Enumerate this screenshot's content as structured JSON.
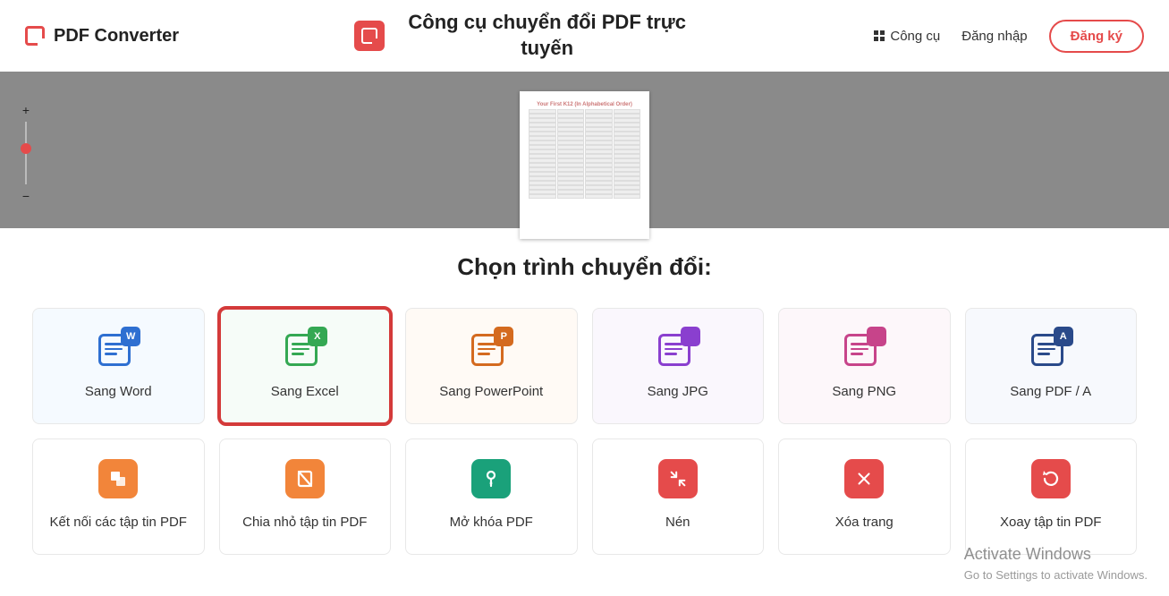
{
  "header": {
    "brand": "PDF Converter",
    "title": "Công cụ chuyển đổi PDF trực tuyến",
    "nav_tools": "Công cụ",
    "nav_login": "Đăng nhập",
    "nav_signup": "Đăng ký"
  },
  "preview": {
    "doc_heading": "Your First K12 (In Alphabetical Order)"
  },
  "section_title": "Chọn trình chuyển đổi:",
  "converters": [
    {
      "label": "Sang Word",
      "badge": "W",
      "tint": "blue",
      "highlight": false
    },
    {
      "label": "Sang Excel",
      "badge": "X",
      "tint": "green",
      "highlight": true
    },
    {
      "label": "Sang PowerPoint",
      "badge": "P",
      "tint": "orange",
      "highlight": false
    },
    {
      "label": "Sang JPG",
      "badge": "",
      "tint": "purple",
      "highlight": false
    },
    {
      "label": "Sang PNG",
      "badge": "",
      "tint": "pink",
      "highlight": false
    },
    {
      "label": "Sang PDF / A",
      "badge": "A",
      "tint": "navy",
      "highlight": false
    }
  ],
  "actions": [
    {
      "label": "Kết nối các tập tin PDF",
      "icon": "merge",
      "color": "orange"
    },
    {
      "label": "Chia nhỏ tập tin PDF",
      "icon": "split",
      "color": "orange"
    },
    {
      "label": "Mở khóa PDF",
      "icon": "unlock",
      "color": "teal"
    },
    {
      "label": "Nén",
      "icon": "compress",
      "color": "red"
    },
    {
      "label": "Xóa trang",
      "icon": "delete",
      "color": "red"
    },
    {
      "label": "Xoay tập tin PDF",
      "icon": "rotate",
      "color": "red"
    }
  ],
  "watermark": {
    "line1": "Activate Windows",
    "line2": "Go to Settings to activate Windows."
  }
}
